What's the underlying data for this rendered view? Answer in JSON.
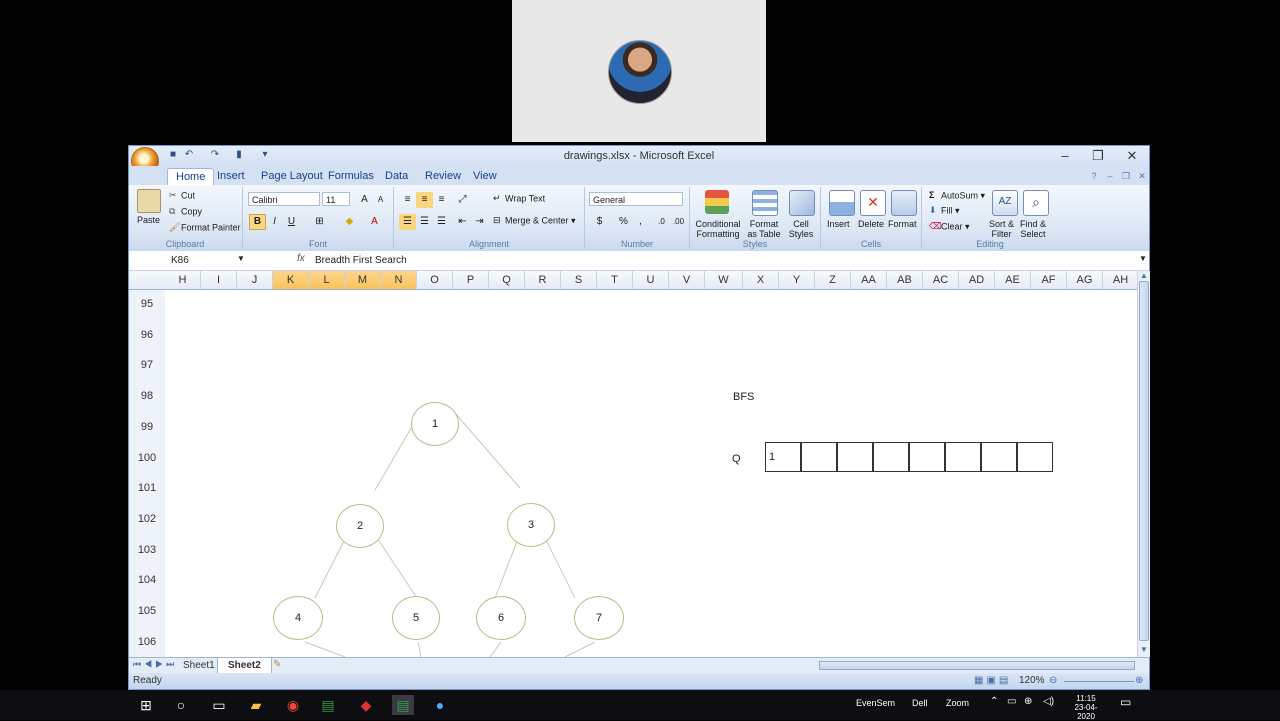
{
  "window": {
    "title": "drawings.xlsx - Microsoft Excel"
  },
  "ribbon": {
    "tabs": [
      "Home",
      "Insert",
      "Page Layout",
      "Formulas",
      "Data",
      "Review",
      "View"
    ],
    "clipboard": {
      "paste": "Paste",
      "cut": "Cut",
      "copy": "Copy",
      "format_painter": "Format Painter",
      "label": "Clipboard"
    },
    "font": {
      "name": "Calibri",
      "size": "11",
      "label": "Font"
    },
    "alignment": {
      "wrap_text": "Wrap Text",
      "merge_center": "Merge & Center",
      "label": "Alignment"
    },
    "number": {
      "format": "General",
      "label": "Number"
    },
    "styles": {
      "conditional": "Conditional",
      "conditional2": "Formatting",
      "format_table": "Format",
      "format_table2": "as Table",
      "cell_styles": "Cell",
      "cell_styles2": "Styles",
      "label": "Styles"
    },
    "cells": {
      "insert": "Insert",
      "delete": "Delete",
      "format": "Format",
      "label": "Cells"
    },
    "editing": {
      "autosum": "AutoSum",
      "fill": "Fill",
      "clear": "Clear",
      "sort": "Sort &",
      "sort2": "Filter",
      "find": "Find &",
      "find2": "Select",
      "label": "Editing"
    }
  },
  "formula_bar": {
    "name_box": "K86",
    "fx": "fx",
    "formula": "Breadth First Search"
  },
  "columns": [
    "H",
    "I",
    "J",
    "K",
    "L",
    "M",
    "N",
    "O",
    "P",
    "Q",
    "R",
    "S",
    "T",
    "U",
    "V",
    "W",
    "X",
    "Y",
    "Z",
    "AA",
    "AB",
    "AC",
    "AD",
    "AE",
    "AF",
    "AG",
    "AH"
  ],
  "selected_columns": [
    "K",
    "L",
    "M",
    "N"
  ],
  "rows": [
    "95",
    "96",
    "97",
    "98",
    "99",
    "100",
    "101",
    "102",
    "103",
    "104",
    "105",
    "106"
  ],
  "sheet": {
    "bfs_label": "BFS",
    "queue_label": "Q",
    "queue_cells": [
      "1",
      "",
      "",
      "",
      "",
      "",
      "",
      ""
    ],
    "tree_nodes": [
      "1",
      "2",
      "3",
      "4",
      "5",
      "6",
      "7"
    ]
  },
  "sheet_tabs": [
    "Sheet1",
    "Sheet2"
  ],
  "active_sheet": "Sheet2",
  "status": {
    "text": "Ready",
    "zoom": "120%"
  },
  "taskbar": {
    "tray_items": [
      "EvenSem",
      "Dell",
      "Zoom"
    ],
    "time": "11:15",
    "date": "23-04-2020"
  },
  "colors": {
    "selected_header": "#f9c25a",
    "node_border": "#b8bd84",
    "ribbon_bg": "#dbe6f4"
  }
}
